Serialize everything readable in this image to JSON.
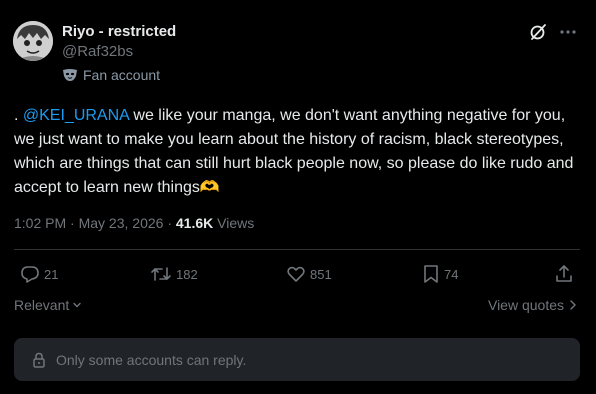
{
  "author": {
    "display_name": "Riyo - restricted",
    "handle": "@Raf32bs",
    "label": "Fan account",
    "avatar_icon": "manga-character-avatar",
    "label_icon": "mask-icon"
  },
  "tweet": {
    "prefix": ". ",
    "mention": "@KEI_URANA",
    "body": " we like your manga, we don't want anything negative for you, we just want to make you learn about the history of racism, black stereotypes, which are things that can still hurt black people now, so please do like rudo and accept to learn new things",
    "emoji": "🫶",
    "emoji_name": "heart-hands"
  },
  "meta": {
    "time": "1:02 PM",
    "separator": "·",
    "date": "May 23, 2026",
    "views_count": "41.6K",
    "views_label": "Views"
  },
  "actions": {
    "replies": "21",
    "reposts": "182",
    "likes": "851",
    "bookmarks": "74"
  },
  "sort": {
    "label": "Relevant"
  },
  "quotes": {
    "label": "View quotes"
  },
  "reply_restriction": {
    "text": "Only some accounts can reply."
  },
  "colors": {
    "background": "#000000",
    "text": "#e7e9ea",
    "muted": "#71767b",
    "mention": "#1d9bf0",
    "reply_box": "#202327"
  }
}
